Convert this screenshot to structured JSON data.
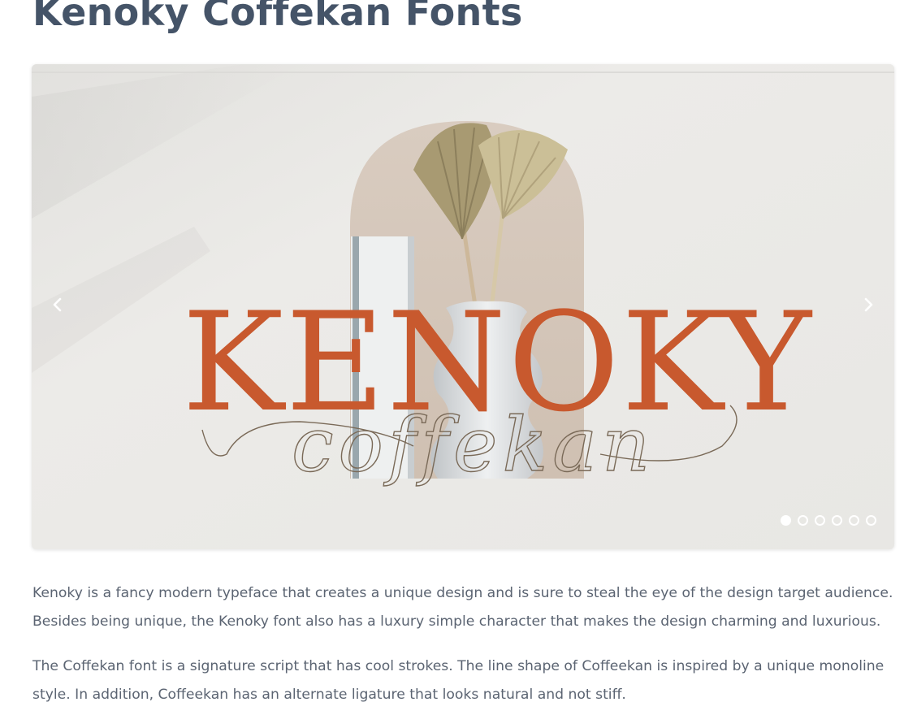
{
  "page": {
    "title": "Kenoky Coffekan Fonts"
  },
  "carousel": {
    "slide_logo_main": "KENOKY",
    "slide_logo_script": "coffekan",
    "slide_count": 6,
    "active_slide": 1,
    "prev_icon": "chevron-left-icon",
    "next_icon": "chevron-right-icon"
  },
  "description": {
    "paragraph_1": "Kenoky is a fancy modern typeface that creates a unique design and is sure to steal the eye of the design target audience. Besides being unique, the Kenoky font also has a luxury simple character that makes the design charming and luxurious.",
    "paragraph_2": "The Coffekan font is a signature script that has cool strokes. The line shape of Coffeekan is inspired by a unique monoline style. In addition, Coffeekan has an alternate ligature that looks natural and not stiff."
  },
  "colors": {
    "title": "#455468",
    "body_text": "#5b6472",
    "logo_orange": "#c8592e",
    "script_brown": "#7a6a58",
    "background_paper": "#ebeae7"
  }
}
